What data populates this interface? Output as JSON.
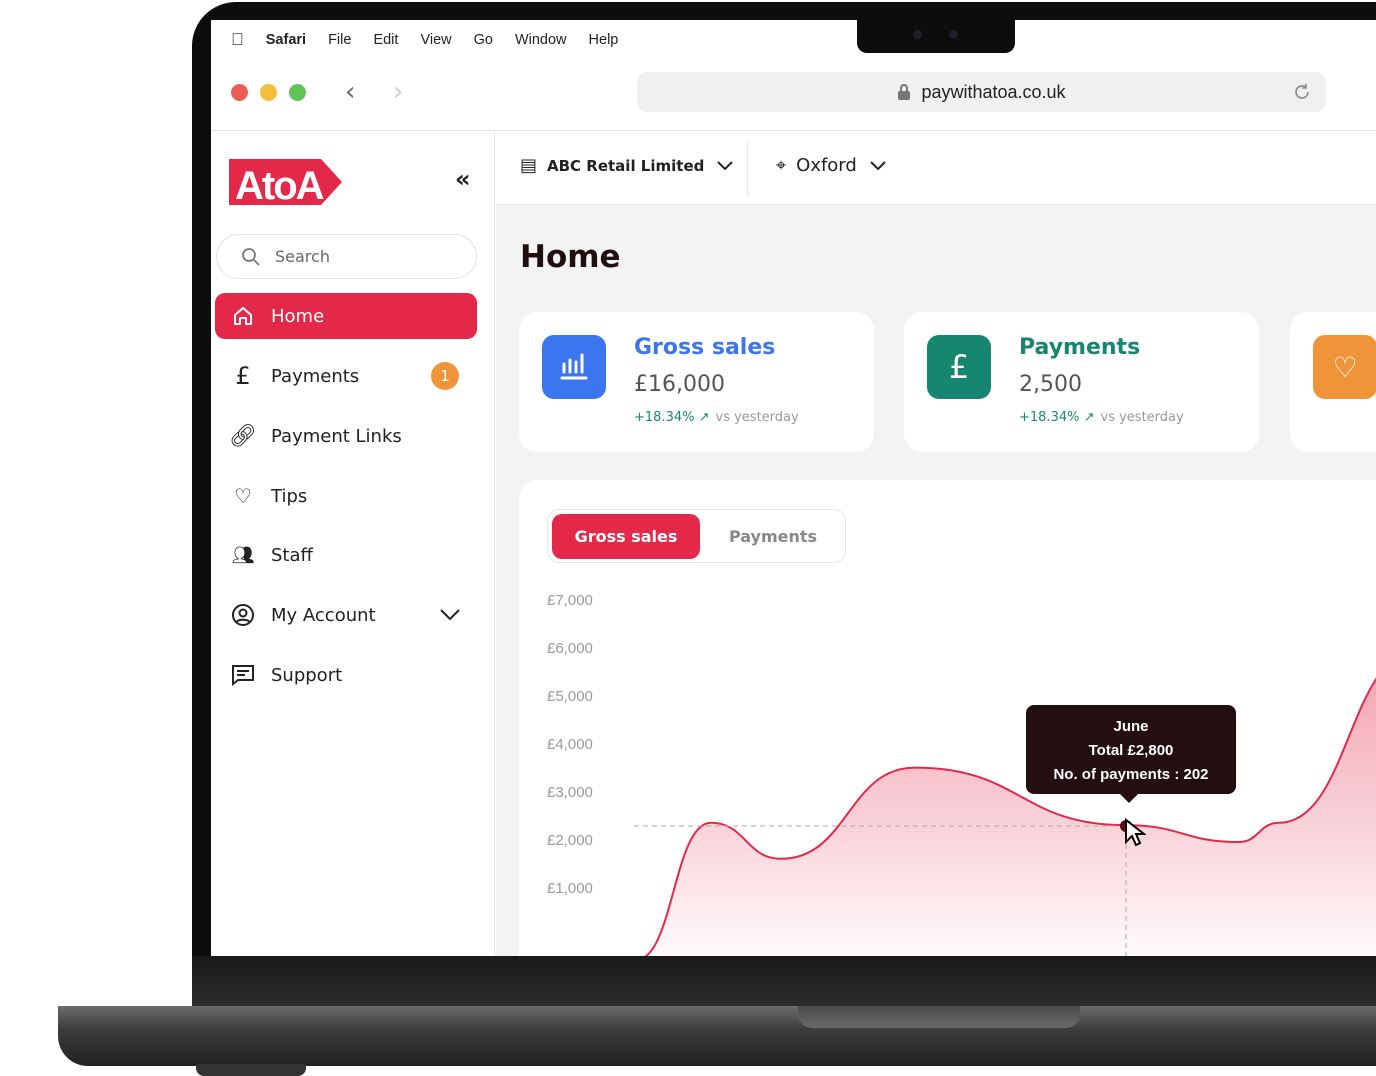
{
  "menubar": {
    "app": "Safari",
    "items": [
      "File",
      "Edit",
      "View",
      "Go",
      "Window",
      "Help"
    ]
  },
  "browser": {
    "url": "paywithatoa.co.uk"
  },
  "sidebar": {
    "logo": "AtoA",
    "search_placeholder": "Search",
    "items": [
      {
        "label": "Home",
        "icon": "home-icon",
        "active": true
      },
      {
        "label": "Payments",
        "icon": "pound-icon",
        "badge": "1"
      },
      {
        "label": "Payment Links",
        "icon": "link-icon"
      },
      {
        "label": "Tips",
        "icon": "hand-heart-icon"
      },
      {
        "label": "Staff",
        "icon": "people-icon"
      },
      {
        "label": "My Account",
        "icon": "user-circle-icon",
        "expandable": true
      },
      {
        "label": "Support",
        "icon": "message-icon"
      }
    ]
  },
  "topbar": {
    "business": "ABC Retail Limited",
    "location": "Oxford"
  },
  "page": {
    "title": "Home"
  },
  "cards": [
    {
      "title": "Gross sales",
      "value": "£16,000",
      "delta": "+18.34%",
      "compare": "vs yesterday",
      "color": "#3b76ef",
      "title_color": "#3b76ef"
    },
    {
      "title": "Payments",
      "value": "2,500",
      "delta": "+18.34%",
      "compare": "vs yesterday",
      "color": "#178670",
      "title_color": "#178670"
    },
    {
      "color": "#f0943a"
    }
  ],
  "chart": {
    "tabs": [
      {
        "label": "Gross sales",
        "active": true
      },
      {
        "label": "Payments",
        "active": false
      }
    ],
    "accent": "#e4284a"
  },
  "chart_data": {
    "type": "area",
    "yticks": [
      "£7,000",
      "£6,000",
      "£5,000",
      "£4,000",
      "£3,000",
      "£2,000",
      "£1,000"
    ],
    "ylim": [
      0,
      7500
    ],
    "values": [
      0,
      2400,
      1650,
      3550,
      2350,
      2000,
      2400,
      6000
    ],
    "tooltip": {
      "month": "June",
      "total": "Total £2,800",
      "payments": "No. of payments : 202"
    }
  }
}
